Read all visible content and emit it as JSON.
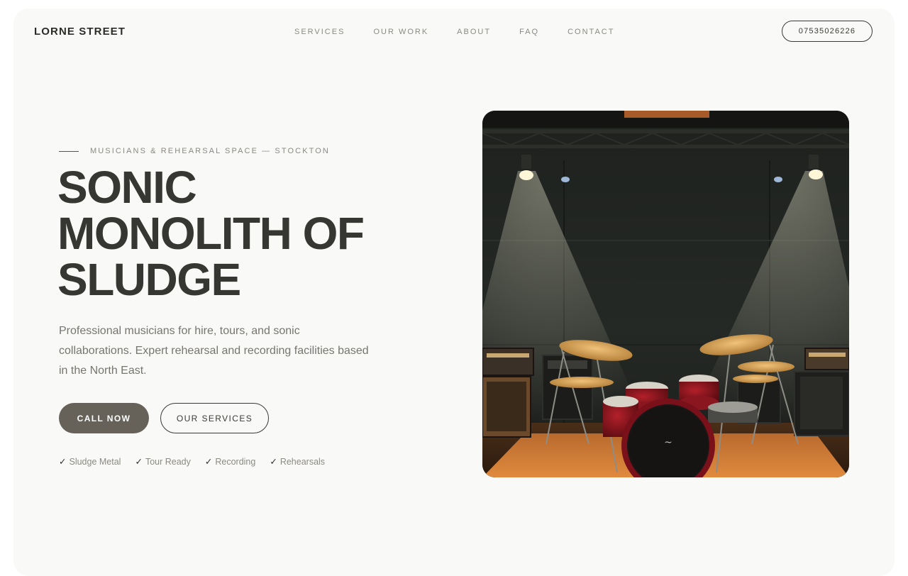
{
  "brand": {
    "name": "LORNE STREET"
  },
  "nav": {
    "items": [
      {
        "label": "SERVICES"
      },
      {
        "label": "OUR WORK"
      },
      {
        "label": "ABOUT"
      },
      {
        "label": "FAQ"
      },
      {
        "label": "CONTACT"
      }
    ],
    "phone": "07535026226"
  },
  "hero": {
    "eyebrow": "MUSICIANS & REHEARSAL SPACE — STOCKTON",
    "title": "SONIC MONOLITH OF SLUDGE",
    "description": "Professional musicians for hire, tours, and sonic collaborations. Expert rehearsal and recording facilities based in the North East.",
    "cta_primary": "CALL NOW",
    "cta_secondary": "OUR SERVICES",
    "check_glyph": "✓",
    "tags": [
      {
        "label": "Sludge Metal"
      },
      {
        "label": "Tour Ready"
      },
      {
        "label": "Recording"
      },
      {
        "label": "Rehearsals"
      }
    ]
  },
  "colors": {
    "page_bg": "#f9f9f7",
    "text_dark": "#363632",
    "text_muted": "#8a8983",
    "button_primary": "#66625a"
  },
  "image": {
    "subject": "drum-kit-rehearsal-room-photo"
  }
}
